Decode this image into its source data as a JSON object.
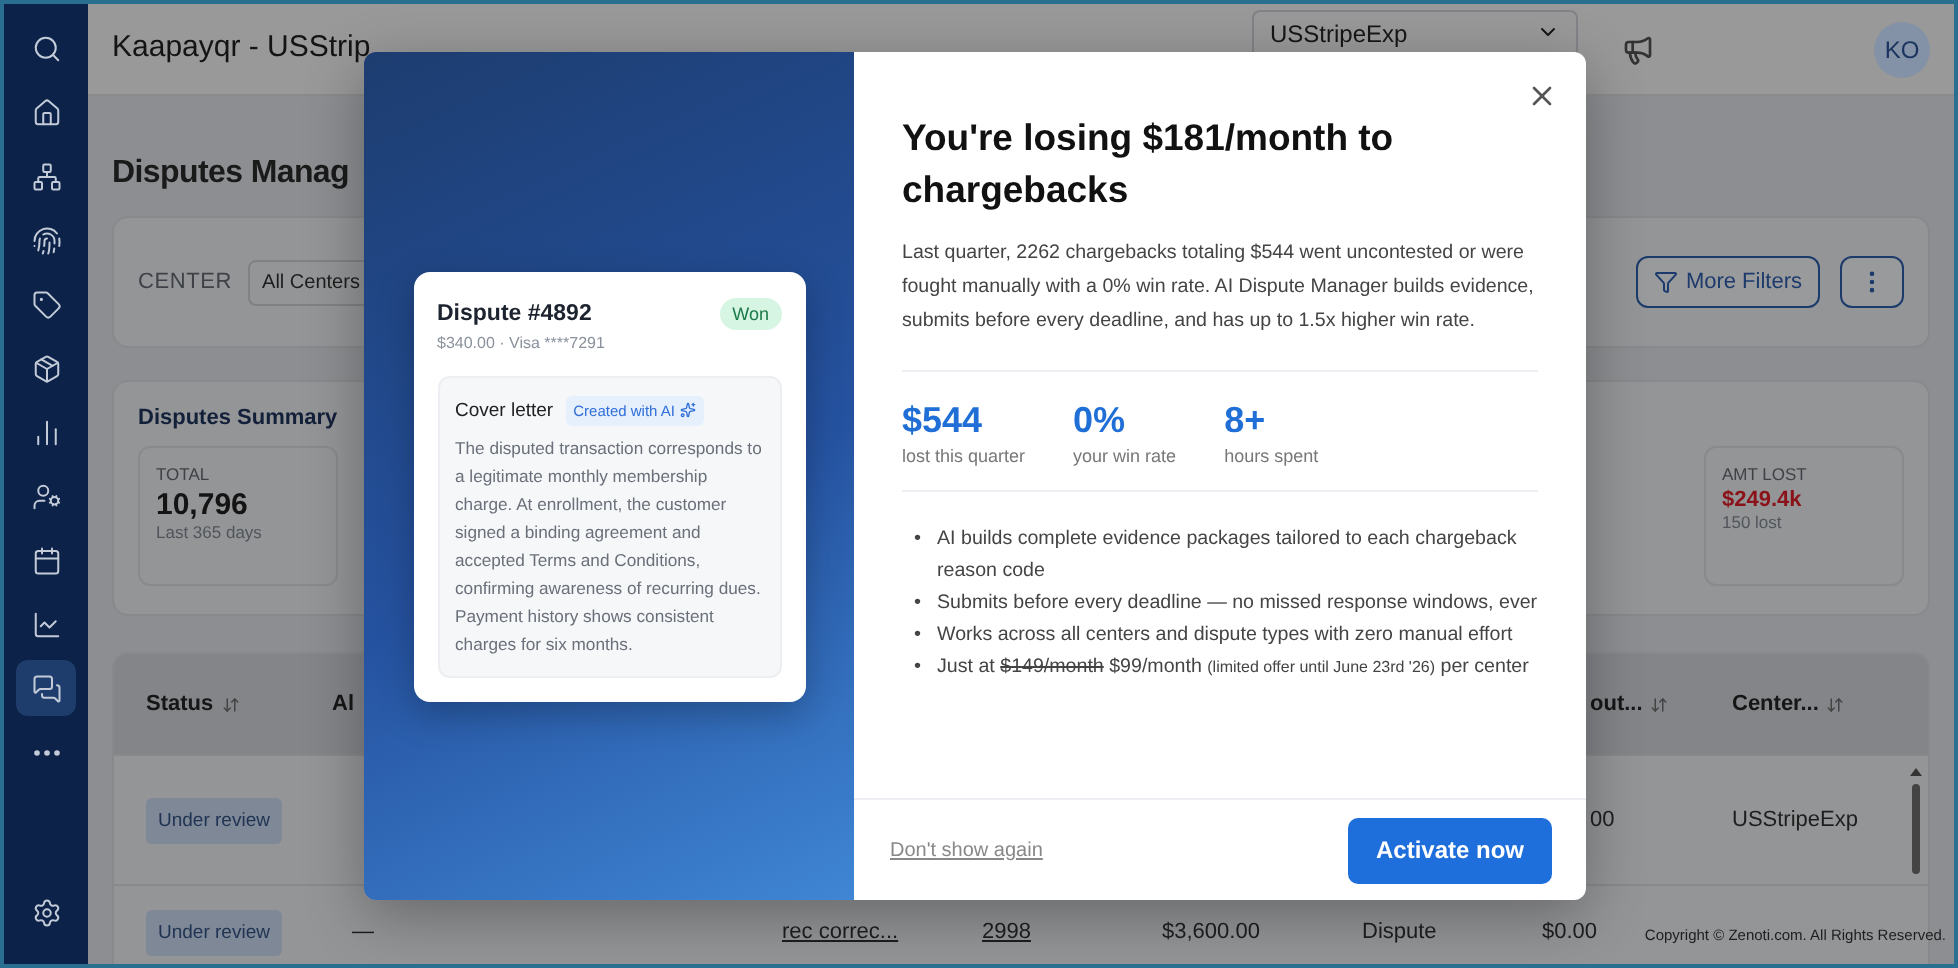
{
  "sidebar": {
    "items": [
      {
        "selected": false
      },
      {
        "selected": false
      },
      {
        "selected": false
      },
      {
        "selected": false
      },
      {
        "selected": false
      },
      {
        "selected": false
      },
      {
        "selected": false
      },
      {
        "selected": false
      },
      {
        "selected": false
      },
      {
        "selected": false
      },
      {
        "selected": true
      },
      {
        "selected": false
      }
    ],
    "bottom_items": [
      {
        "selected": false
      }
    ]
  },
  "header": {
    "title": "Kaapayqr - USStrip",
    "center_select": "USStripeExp",
    "avatar": "KO"
  },
  "page_title": "Disputes Manag",
  "filters": {
    "label": "CENTER",
    "center_value": "All Centers",
    "more_filters": "More Filters"
  },
  "summary": {
    "title": "Disputes Summary",
    "stats": [
      {
        "kind": "count",
        "label": "TOTAL",
        "value": "10,796",
        "note": "Last 365 days"
      },
      {
        "kind": "loss",
        "label": "AMT LOST",
        "value": "$249.4k",
        "note": "150 lost"
      }
    ]
  },
  "table": {
    "columns": [
      {
        "kind": "sortable",
        "label": "Status"
      },
      {
        "kind": "plain",
        "label": "Al"
      },
      {
        "kind": "blank"
      },
      {
        "kind": "blank"
      },
      {
        "kind": "blank"
      },
      {
        "kind": "blank"
      },
      {
        "kind": "sortable_cut",
        "label": "out..."
      },
      {
        "kind": "sortable",
        "label": "Center..."
      }
    ],
    "rows": [
      {
        "cells": [
          {
            "kind": "status",
            "text": "Under review"
          },
          {
            "kind": "blank"
          },
          {
            "kind": "blank"
          },
          {
            "kind": "blank"
          },
          {
            "kind": "blank"
          },
          {
            "kind": "blank"
          },
          {
            "kind": "text_cut",
            "text": "00"
          },
          {
            "kind": "text",
            "text": "USStripeExp"
          }
        ]
      },
      {
        "cells": [
          {
            "kind": "status",
            "text": "Under review"
          },
          {
            "kind": "text",
            "text": "—"
          },
          {
            "kind": "link",
            "text": "rec correc..."
          },
          {
            "kind": "link",
            "text": "2998"
          },
          {
            "kind": "text",
            "text": "$3,600.00"
          },
          {
            "kind": "text",
            "text": "Dispute"
          },
          {
            "kind": "text",
            "text": "$0.00"
          },
          {
            "kind": "blank"
          }
        ]
      }
    ]
  },
  "copyright": "Copyright © Zenoti.com. All Rights Reserved.",
  "modal": {
    "card": {
      "title": "Dispute #4892",
      "subtitle": "$340.00 · Visa ****7291",
      "status": "Won",
      "section_title": "Cover letter",
      "ai_badge": "Created with AI",
      "body": "The disputed transaction corresponds to a legitimate monthly membership charge. At enrollment, the customer signed a binding agreement and accepted Terms and Conditions, confirming awareness of recurring dues. Payment history shows consistent charges for six months."
    },
    "heading": "You're losing $181/month to chargebacks",
    "description": "Last quarter, 2262 chargebacks totaling $544 went uncontested or were fought manually with a 0% win rate. AI Dispute Manager builds evidence, submits before every deadline, and has up to 1.5x higher win rate.",
    "stats": [
      {
        "value": "$544",
        "label": "lost this quarter"
      },
      {
        "value": "0%",
        "label": "your win rate"
      },
      {
        "value": "8+",
        "label": "hours spent"
      }
    ],
    "benefits": [
      {
        "kind": "text",
        "marker": "•",
        "text": "AI builds complete evidence packages tailored to each chargeback reason code"
      },
      {
        "kind": "text",
        "marker": "•",
        "text": "Submits before every deadline — no missed response windows, ever"
      },
      {
        "kind": "text",
        "marker": "•",
        "text": "Works across all centers and dispute types with zero manual effort"
      },
      {
        "kind": "offer",
        "marker": "•",
        "prefix": "Just at",
        "old_price": "$149/month",
        "price": "$99/month",
        "note": "(limited offer until June 23rd '26)",
        "suffix": "per center"
      }
    ],
    "dismiss": "Don't show again",
    "cta": "Activate now"
  }
}
